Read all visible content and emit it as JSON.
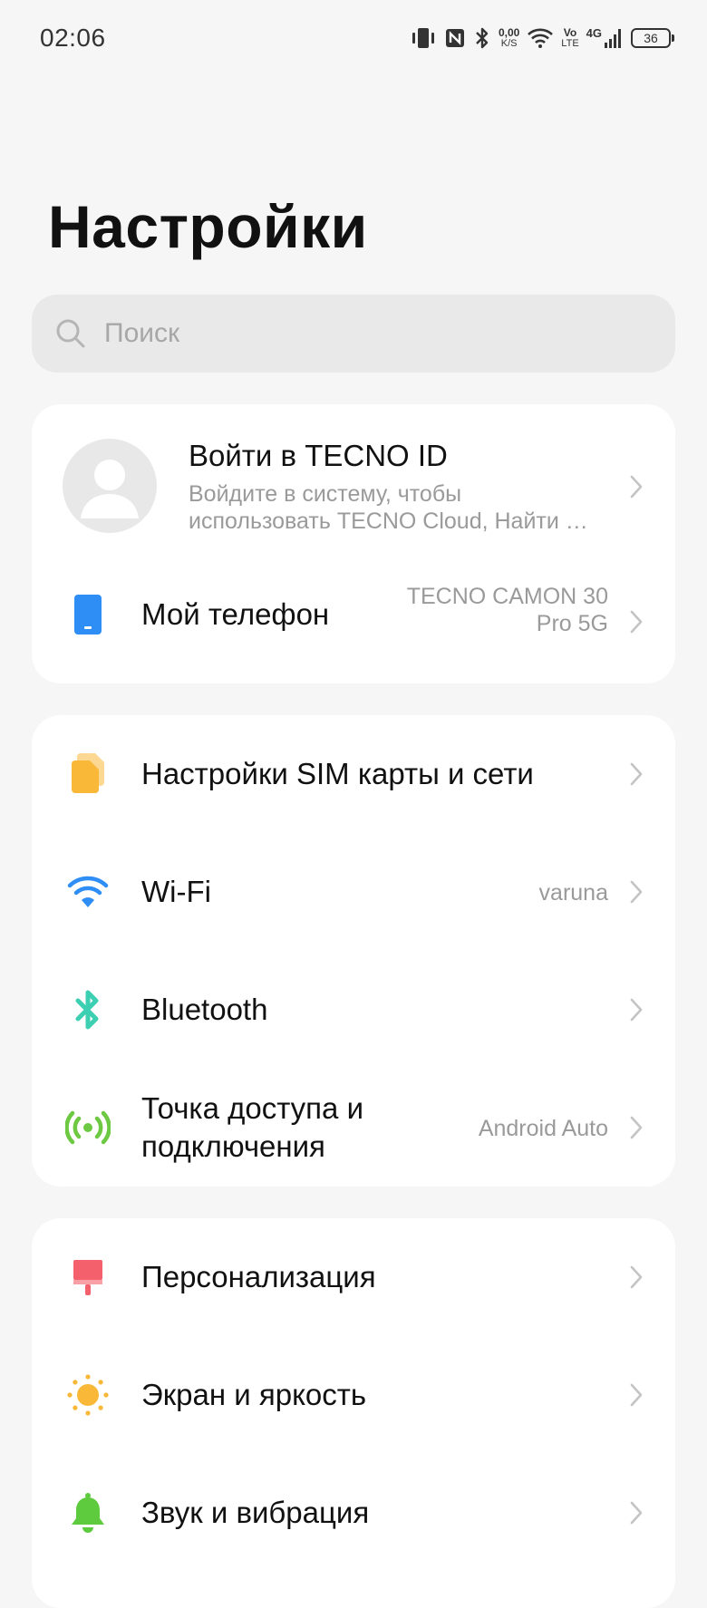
{
  "status_bar": {
    "time": "02:06",
    "net_speed_value": "0,00",
    "net_speed_unit": "K/S",
    "volte_top": "Vo",
    "volte_bottom": "LTE",
    "network_gen": "4G",
    "battery_level": "36"
  },
  "page_title": "Настройки",
  "search": {
    "placeholder": "Поиск"
  },
  "account": {
    "title": "Войти в TECNO ID",
    "subtitle_line1": "Войдите в систему, чтобы",
    "subtitle_line2": "использовать TECNO Cloud, Найти …"
  },
  "my_phone": {
    "label": "Мой телефон",
    "value_line1": "TECNO CAMON 30",
    "value_line2": "Pro 5G"
  },
  "network_items": [
    {
      "label": "Настройки SIM карты и сети",
      "value": "",
      "icon": "sim-card-icon"
    },
    {
      "label": "Wi-Fi",
      "value": "varuna",
      "icon": "wifi-icon"
    },
    {
      "label": "Bluetooth",
      "value": "",
      "icon": "bluetooth-icon"
    },
    {
      "label_line1": "Точка доступа и",
      "label_line2": "подключения",
      "value": "Android Auto",
      "icon": "hotspot-icon"
    }
  ],
  "display_items": [
    {
      "label": "Персонализация",
      "icon": "brush-icon"
    },
    {
      "label": "Экран и яркость",
      "icon": "sun-icon"
    },
    {
      "label": "Звук и вибрация",
      "icon": "bell-icon"
    }
  ],
  "colors": {
    "phone_icon": "#2f8ef5",
    "sim_icon": "#f9b838",
    "wifi_icon": "#2f8ef5",
    "bluetooth_icon": "#3ccfb1",
    "hotspot_icon": "#6cc941",
    "brush_icon": "#f4606b",
    "sun_icon": "#f9b838",
    "bell_icon": "#5ecb3e"
  }
}
